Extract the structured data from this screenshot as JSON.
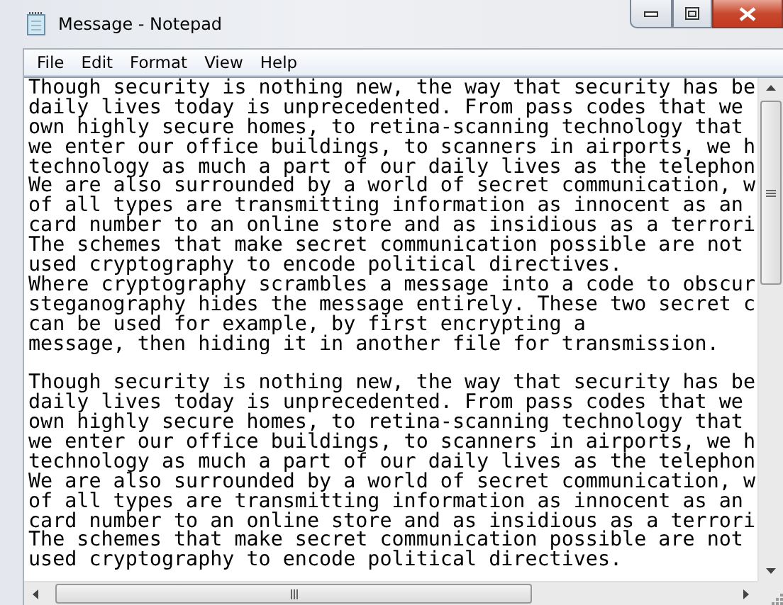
{
  "window": {
    "title": "Message - Notepad"
  },
  "menu": [
    "File",
    "Edit",
    "Format",
    "View",
    "Help"
  ],
  "editor": {
    "paragraphs": [
      [
        "Though security is nothing new, the way that security has be",
        "daily lives today is unprecedented. From pass codes that we",
        "own highly secure homes, to retina-scanning technology that",
        "we enter our office buildings, to scanners in airports, we h",
        "technology as much a part of our daily lives as the telephon",
        "We are also surrounded by a world of secret communication, w",
        "of all types are transmitting information as innocent as an",
        "card number to an online store and as insidious as a terrori",
        "The schemes that make secret communication possible are not",
        "used cryptography to encode political directives.",
        "Where cryptography scrambles a message into a code to obscur",
        "steganography hides the message entirely. These two secret c",
        "can be used for example, by first encrypting a",
        "message, then hiding it in another file for transmission."
      ],
      [
        "Though security is nothing new, the way that security has be",
        "daily lives today is unprecedented. From pass codes that we",
        "own highly secure homes, to retina-scanning technology that",
        "we enter our office buildings, to scanners in airports, we h",
        "technology as much a part of our daily lives as the telephon",
        "We are also surrounded by a world of secret communication, w",
        "of all types are transmitting information as innocent as an",
        "card number to an online store and as insidious as a terrori",
        "The schemes that make secret communication possible are not",
        "used cryptography to encode political directives."
      ]
    ]
  }
}
